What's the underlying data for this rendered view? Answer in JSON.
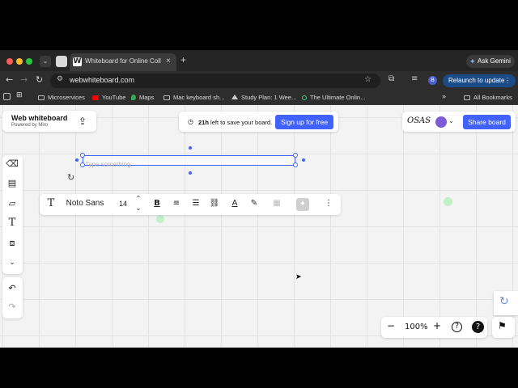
{
  "browser": {
    "tab_title": "Whiteboard for Online Collab",
    "tab_favicon": "W",
    "new_tab": "+",
    "tab_close": "×",
    "gemini_label": "Ask Gemini",
    "url": "webwhiteboard.com",
    "profile_initial": "B",
    "relaunch_label": "Relaunch to update",
    "bookmarks": [
      "Microservices",
      "YouTube",
      "Maps",
      "Mac keyboard sh...",
      "Study Plan: 1 Wee...",
      "The Ultimate Onlin..."
    ],
    "all_bookmarks": "All Bookmarks",
    "more_bookmarks": "»"
  },
  "app": {
    "brand_title": "Web whiteboard",
    "brand_subtitle": "Powered by Miro",
    "trial_hours": "21h",
    "trial_text": " left to save your board.",
    "signup_label": "Sign up for free",
    "share_label": "Share board",
    "logo_text": "OSAS"
  },
  "toolbar": {
    "icons": [
      "eraser-icon",
      "frame-icon",
      "sticky-note-icon",
      "text-icon",
      "shapes-icon",
      "more-tools-icon",
      "undo-icon",
      "redo-icon"
    ]
  },
  "format_bar": {
    "font_name": "Noto Sans",
    "font_size": "14"
  },
  "canvas": {
    "text_placeholder": "Type something"
  },
  "zoom": {
    "level": "100%",
    "minus": "−",
    "plus": "+",
    "help": "?"
  },
  "colors": {
    "accent": "#4262ff",
    "green_dot": "#bff0c9"
  }
}
